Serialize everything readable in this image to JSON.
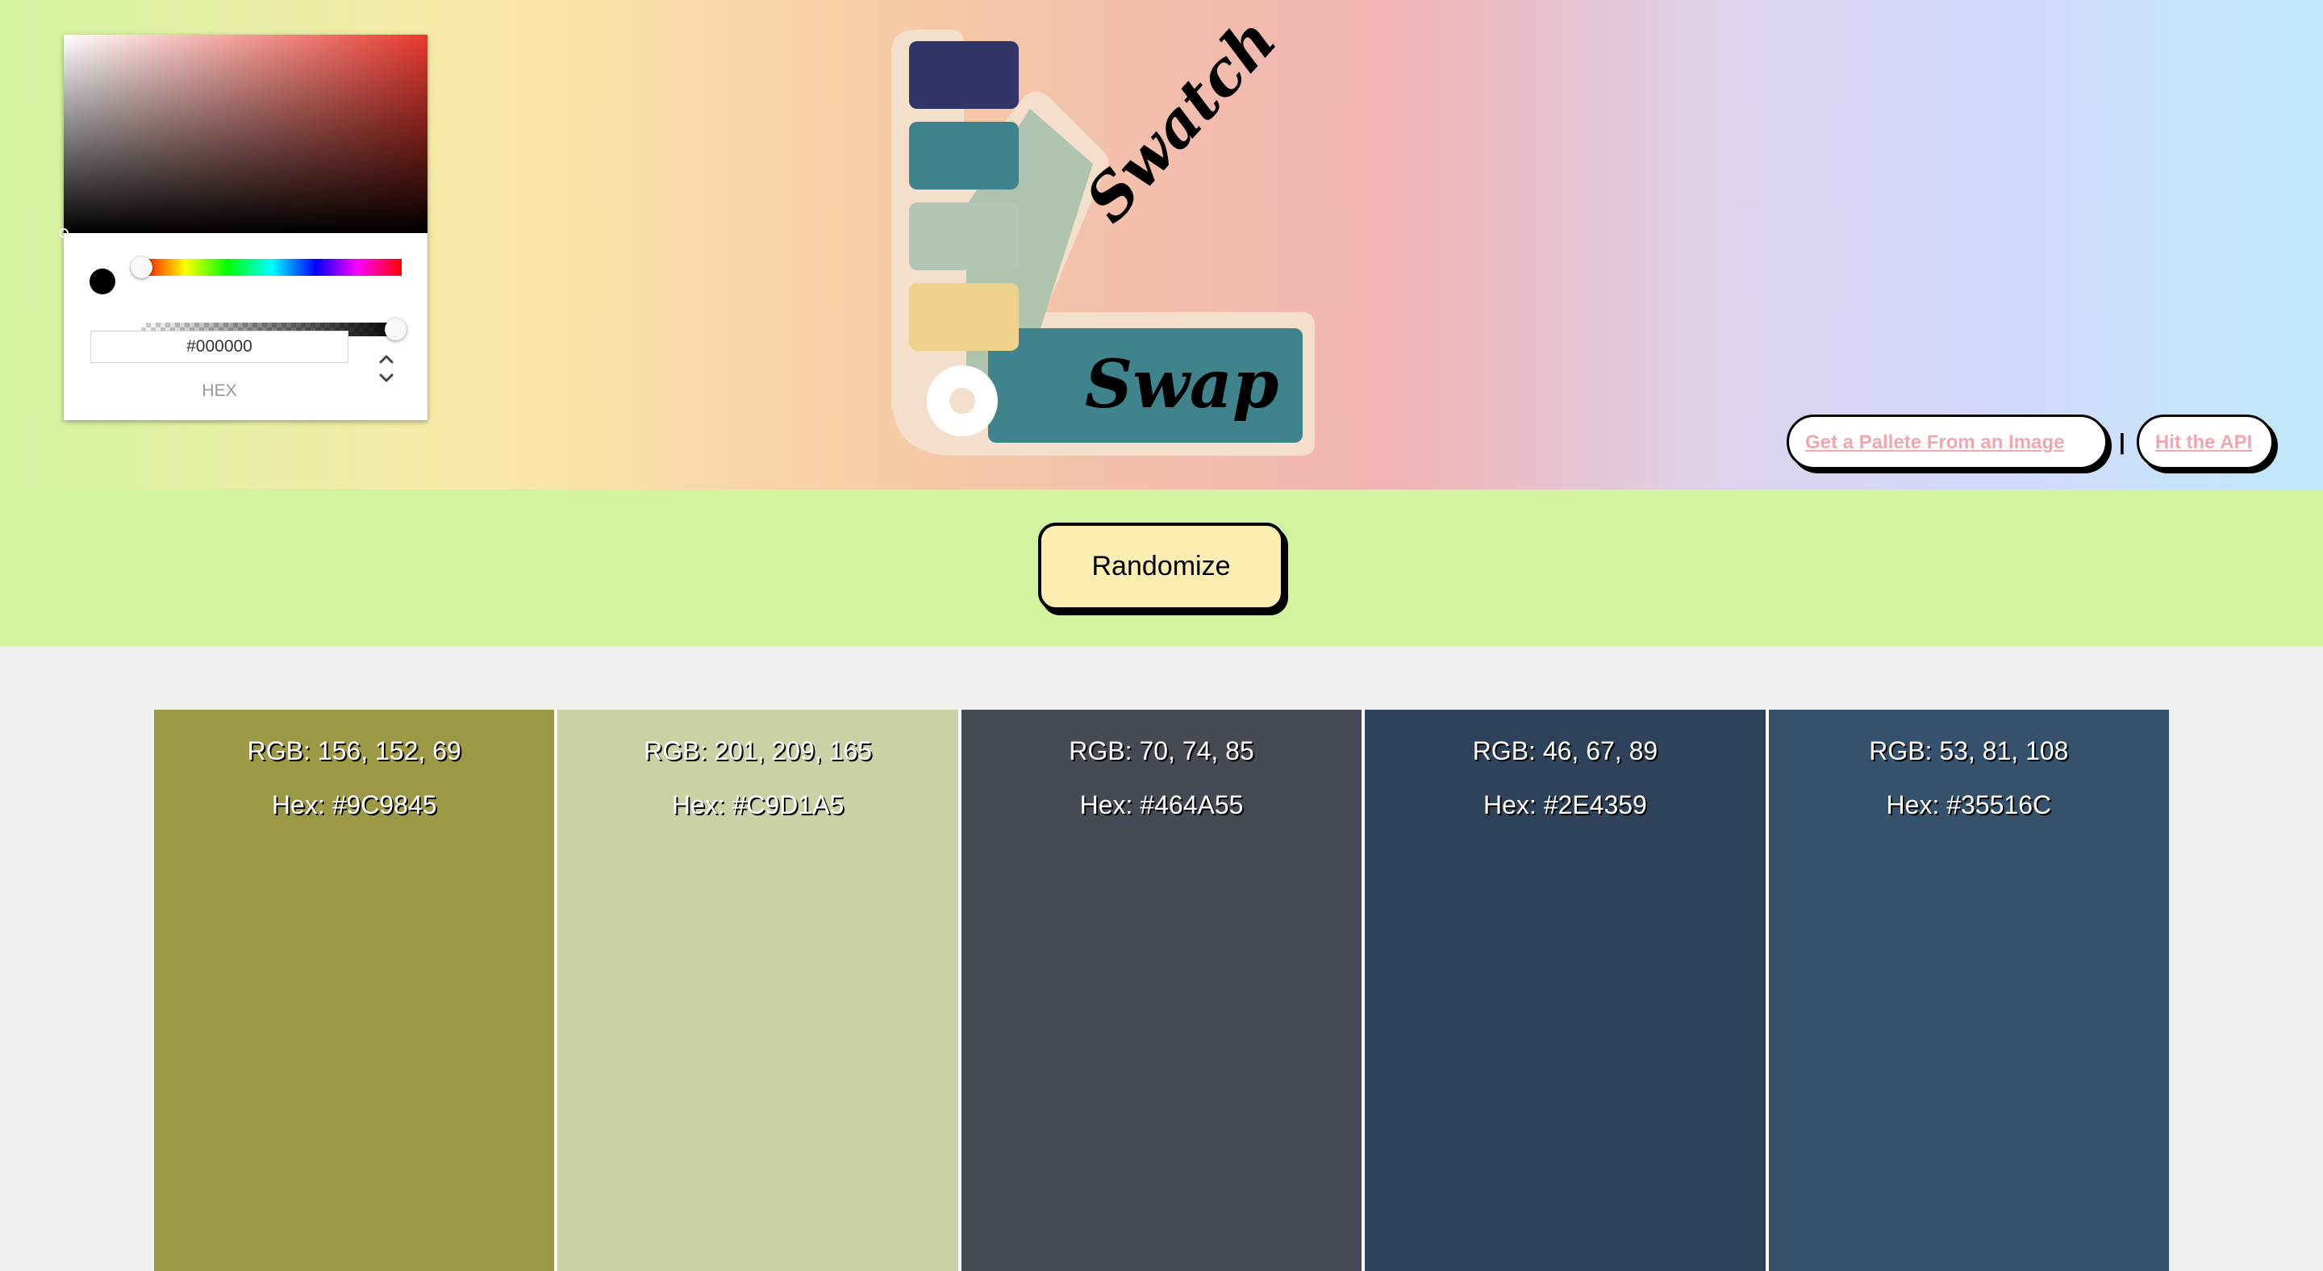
{
  "color_picker": {
    "hex_value": "#000000",
    "format_label": "HEX",
    "current_color": "#000000"
  },
  "logo": {
    "line1": "Swatch",
    "line2": "Swap",
    "swatch_colors": [
      "#313567",
      "#3f838c",
      "#b2c6b4",
      "#edd289"
    ]
  },
  "nav": {
    "image_link": "Get a Pallete From an Image",
    "separator": "|",
    "api_link": "Hit the API"
  },
  "randomize_label": "Randomize",
  "swatches": [
    {
      "rgb": "RGB: 156, 152, 69",
      "hex": "Hex: #9C9845",
      "color": "#9C9845"
    },
    {
      "rgb": "RGB: 201, 209, 165",
      "hex": "Hex: #C9D1A5",
      "color": "#C9D1A5"
    },
    {
      "rgb": "RGB: 70, 74, 85",
      "hex": "Hex: #464A55",
      "color": "#464A55"
    },
    {
      "rgb": "RGB: 46, 67, 89",
      "hex": "Hex: #2E4359",
      "color": "#2E4359"
    },
    {
      "rgb": "RGB: 53, 81, 108",
      "hex": "Hex: #35516C",
      "color": "#35516C"
    }
  ]
}
